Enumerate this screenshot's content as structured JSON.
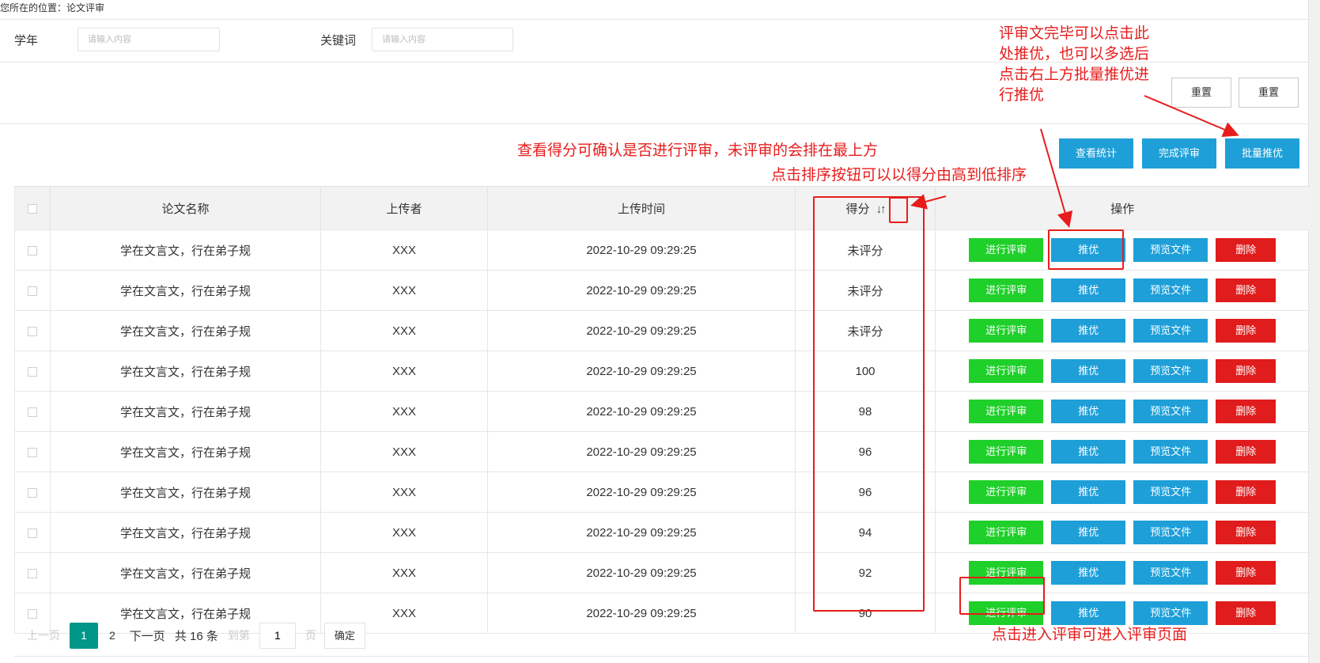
{
  "breadcrumb": "您所在的位置：论文评审",
  "search": {
    "year_label": "学年",
    "year_placeholder": "请输入内容",
    "keyword_label": "关键词",
    "keyword_placeholder": "请输入内容"
  },
  "form_buttons": {
    "reset1": "重置",
    "reset2": "重置"
  },
  "toolbar": {
    "stats": "查看统计",
    "complete": "完成评审",
    "batch": "批量推优"
  },
  "table": {
    "headers": {
      "name": "论文名称",
      "uploader": "上传者",
      "time": "上传时间",
      "score": "得分",
      "ops": "操作"
    },
    "sort_icon": "sort-icon",
    "rows": [
      {
        "name": "学在文言文，行在弟子规",
        "uploader": "XXX",
        "time": "2022-10-29 09:29:25",
        "score": "未评分"
      },
      {
        "name": "学在文言文，行在弟子规",
        "uploader": "XXX",
        "time": "2022-10-29 09:29:25",
        "score": "未评分"
      },
      {
        "name": "学在文言文，行在弟子规",
        "uploader": "XXX",
        "time": "2022-10-29 09:29:25",
        "score": "未评分"
      },
      {
        "name": "学在文言文，行在弟子规",
        "uploader": "XXX",
        "time": "2022-10-29 09:29:25",
        "score": "100"
      },
      {
        "name": "学在文言文，行在弟子规",
        "uploader": "XXX",
        "time": "2022-10-29 09:29:25",
        "score": "98"
      },
      {
        "name": "学在文言文，行在弟子规",
        "uploader": "XXX",
        "time": "2022-10-29 09:29:25",
        "score": "96"
      },
      {
        "name": "学在文言文，行在弟子规",
        "uploader": "XXX",
        "time": "2022-10-29 09:29:25",
        "score": "96"
      },
      {
        "name": "学在文言文，行在弟子规",
        "uploader": "XXX",
        "time": "2022-10-29 09:29:25",
        "score": "94"
      },
      {
        "name": "学在文言文，行在弟子规",
        "uploader": "XXX",
        "time": "2022-10-29 09:29:25",
        "score": "92"
      },
      {
        "name": "学在文言文，行在弟子规",
        "uploader": "XXX",
        "time": "2022-10-29 09:29:25",
        "score": "90"
      }
    ],
    "ops": {
      "review": "进行评审",
      "recommend": "推优",
      "preview": "预览文件",
      "delete": "删除"
    }
  },
  "pager": {
    "prev": "上一页",
    "current": "1",
    "page2": "2",
    "next": "下一页",
    "total": "共 16 条",
    "goto": "到第",
    "goto_value": "1",
    "unit": "页",
    "confirm": "确定"
  },
  "annotations": {
    "recommend_note_1": "评审文完毕可以点击此",
    "recommend_note_2": "处推优，也可以多选后",
    "recommend_note_3": "点击右上方批量推优进",
    "recommend_note_4": "行推优",
    "score_note": "查看得分可确认是否进行评审，未评审的会排在最上方",
    "sort_note": "点击排序按钮可以以得分由高到低排序",
    "review_note": "点击进入评审可进入评审页面"
  },
  "colors": {
    "annotation_red": "#e81c1c",
    "primary_blue": "#1e9fd8",
    "review_green": "#1fd02a",
    "delete_red": "#e01c1c",
    "pager_teal": "#009688"
  }
}
